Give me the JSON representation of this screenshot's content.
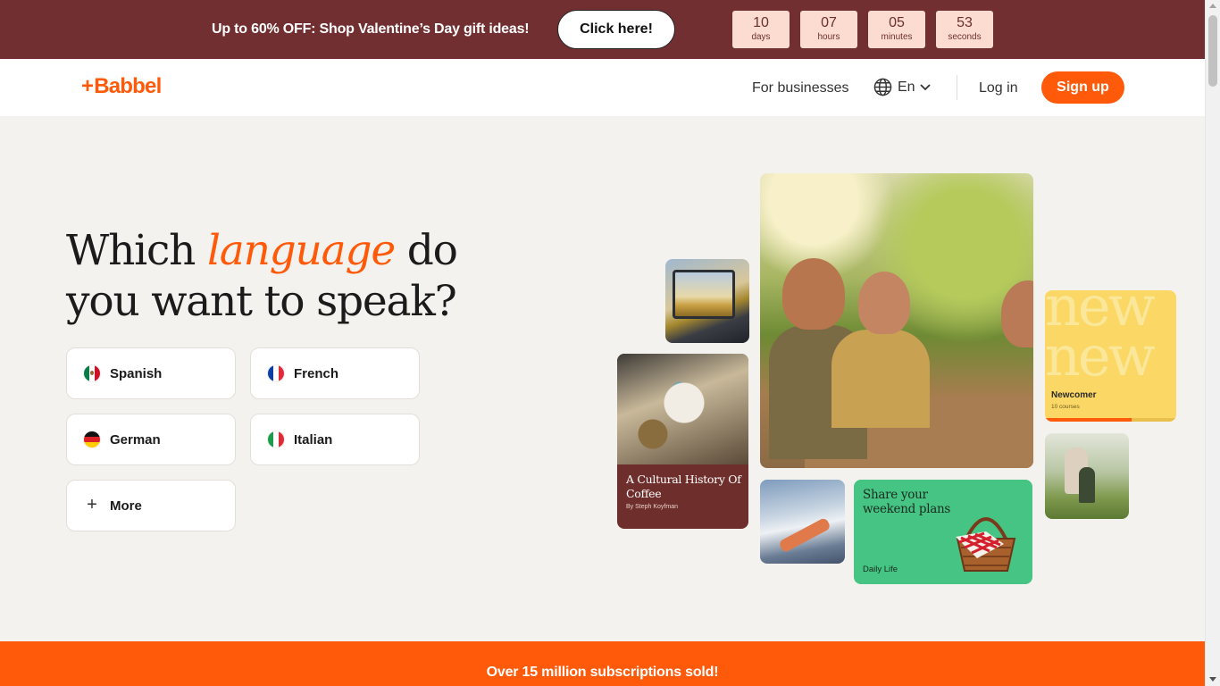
{
  "promo": {
    "text": "Up to 60% OFF: Shop Valentine’s Day gift ideas!",
    "button_label": "Click here!",
    "countdown": [
      {
        "value": "10",
        "label": "days"
      },
      {
        "value": "07",
        "label": "hours"
      },
      {
        "value": "05",
        "label": "minutes"
      },
      {
        "value": "53",
        "label": "seconds"
      }
    ]
  },
  "header": {
    "logo": "Babbel",
    "logo_plus": "+",
    "for_businesses": "For businesses",
    "language": "En",
    "login": "Log in",
    "signup": "Sign up"
  },
  "hero": {
    "title_part1": "Which ",
    "title_accent": "language",
    "title_part2": " do",
    "title_line2": "you want to speak?",
    "languages": [
      {
        "label": "Spanish",
        "icon": "mexico-flag-icon"
      },
      {
        "label": "French",
        "icon": "france-flag-icon"
      },
      {
        "label": "German",
        "icon": "germany-flag-icon"
      },
      {
        "label": "Italian",
        "icon": "italy-flag-icon"
      }
    ],
    "more_label": "More",
    "more_icon": "plus-icon"
  },
  "collage": {
    "coffee_title": "A Cultural History Of Coffee",
    "coffee_author": "By Steph Koyfman",
    "new_watermark": "new",
    "newcomer_label": "Newcomer",
    "newcomer_courses": "10 courses",
    "newcomer_progress": 0.66,
    "weekend_title": "Share your weekend plans",
    "weekend_tag": "Daily Life"
  },
  "stats": {
    "text": "Over 15 million subscriptions sold!"
  },
  "colors": {
    "brand": "#ff5a0a",
    "promo_bg": "#722f31",
    "countdown_bg": "#fcdcd0",
    "page_bg": "#f4f2ee"
  }
}
